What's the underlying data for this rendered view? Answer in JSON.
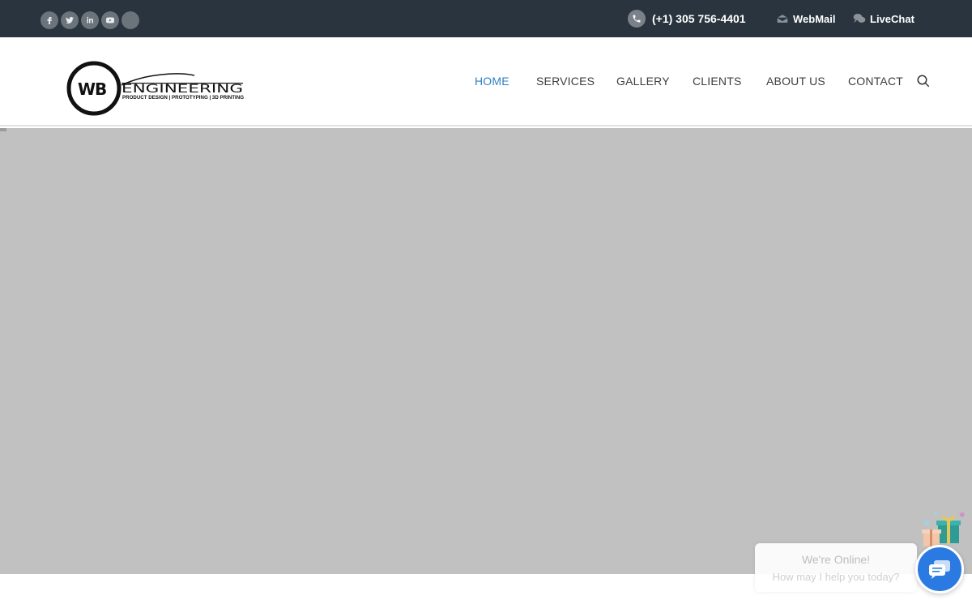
{
  "topbar": {
    "social": [
      {
        "name": "facebook-icon",
        "glyph": "f"
      },
      {
        "name": "twitter-icon",
        "glyph": ""
      },
      {
        "name": "linkedin-icon",
        "glyph": "in"
      },
      {
        "name": "youtube-icon",
        "glyph": ""
      },
      {
        "name": "social-icon",
        "glyph": ""
      }
    ],
    "phone": "(+1) 305 756-4401",
    "webmail": "WebMail",
    "livechat": "LiveChat"
  },
  "nav": {
    "items": [
      "HOME",
      "SERVICES",
      "GALLERY",
      "CLIENTS",
      "ABOUT US",
      "CONTACT"
    ],
    "active": "HOME"
  },
  "logo": {
    "mark": "WB",
    "word": "ENGINEERING",
    "tagline": "PRODUCT DESIGN | PROTOTYPING | 3D PRINTING"
  },
  "chat": {
    "title": "We're Online!",
    "subtitle": "How may I help you today?"
  },
  "colors": {
    "topbar": "#29343e",
    "accent": "#2f7fc1",
    "hero": "#c1c1c1",
    "chat_button": "#2a7ae2"
  }
}
